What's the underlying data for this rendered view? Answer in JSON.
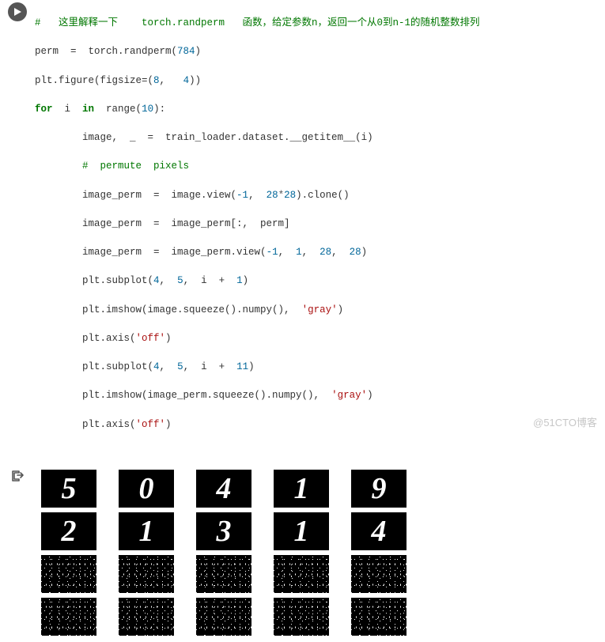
{
  "code": {
    "comment_main": "#   这里解释一下    torch.randperm   函数，给定参数n，返回一个从0到n-1的随机整数排列",
    "l2a": "perm  =  torch.randperm(",
    "l2b": "784",
    "l2c": ")",
    "l3a": "plt.figure(figsize=(",
    "l3b": "8",
    "l3c": ",   ",
    "l3d": "4",
    "l3e": "))",
    "l4a": "for",
    "l4b": "  i  ",
    "l4c": "in",
    "l4d": "  range(",
    "l4e": "10",
    "l4f": "):",
    "l5a": "        image,  _  =  train_loader.dataset.__getitem__(i)",
    "l6a": "        ",
    "l6b": "#  permute  pixels",
    "l7a": "        image_perm  =  image.view(",
    "l7b": "-1",
    "l7c": ",  ",
    "l7d": "28",
    "l7e": "*",
    "l7f": "28",
    "l7g": ").clone()",
    "l8a": "        image_perm  =  image_perm[:,  perm]",
    "l9a": "        image_perm  =  image_perm.view(",
    "l9b": "-1",
    "l9c": ",  ",
    "l9d": "1",
    "l9e": ",  ",
    "l9f": "28",
    "l9g": ",  ",
    "l9h": "28",
    "l9i": ")",
    "l10a": "        plt.subplot(",
    "l10b": "4",
    "l10c": ",  ",
    "l10d": "5",
    "l10e": ",  i  +  ",
    "l10f": "1",
    "l10g": ")",
    "l11a": "        plt.imshow(image.squeeze().numpy(),  ",
    "l11b": "'gray'",
    "l11c": ")",
    "l12a": "        plt.axis(",
    "l12b": "'off'",
    "l12c": ")",
    "l13a": "        plt.subplot(",
    "l13b": "4",
    "l13c": ",  ",
    "l13d": "5",
    "l13e": ",  i  +  ",
    "l13f": "11",
    "l13g": ")",
    "l14a": "        plt.imshow(image_perm.squeeze().numpy(),  ",
    "l14b": "'gray'",
    "l14c": ")",
    "l15a": "        plt.axis(",
    "l15b": "'off'",
    "l15c": ")"
  },
  "output": {
    "row1": [
      "5",
      "0",
      "4",
      "1",
      "9"
    ],
    "row2": [
      "2",
      "1",
      "3",
      "1",
      "4"
    ]
  },
  "watermark": "@51CTO博客",
  "chart_data": {
    "type": "table",
    "title": "MNIST digits (top 2 rows) and pixel-permuted versions (bottom 2 rows)",
    "grid_shape": [
      4,
      5
    ],
    "rows": [
      {
        "kind": "digit",
        "labels": [
          "5",
          "0",
          "4",
          "1",
          "9"
        ]
      },
      {
        "kind": "digit",
        "labels": [
          "2",
          "1",
          "3",
          "1",
          "4"
        ]
      },
      {
        "kind": "permuted_noise",
        "labels": [
          null,
          null,
          null,
          null,
          null
        ]
      },
      {
        "kind": "permuted_noise",
        "labels": [
          null,
          null,
          null,
          null,
          null
        ]
      }
    ],
    "cmap": "gray",
    "figsize": [
      8,
      4
    ]
  }
}
